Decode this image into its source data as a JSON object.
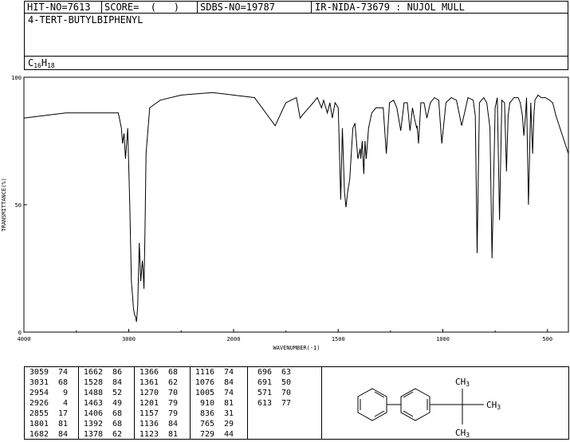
{
  "header": {
    "hit_no": "HIT-NO=7613",
    "score": "SCORE=  (   )",
    "sdbs_no": "SDBS-NO=19787",
    "ir_nida": "IR-NIDA-73679 : NUJOL MULL"
  },
  "compound_name": "4-TERT-BUTYLBIPHENYL",
  "formula": {
    "c": "C",
    "c_count": "16",
    "h": "H",
    "h_count": "18"
  },
  "chart_data": {
    "type": "line",
    "xlabel": "WAVENUMBER(-1)",
    "ylabel": "TRANSMITTANCE(%)",
    "xlim": [
      4000,
      400
    ],
    "ylim": [
      0,
      100
    ],
    "x_ticks": [
      4000,
      3000,
      2000,
      1500,
      1000,
      500
    ],
    "y_ticks": [
      0,
      50,
      100
    ],
    "series": [
      {
        "x": [
          4000,
          3800,
          3600,
          3400,
          3200,
          3100,
          3070,
          3059,
          3045,
          3031,
          3010,
          2990,
          2975,
          2960,
          2954,
          2945,
          2935,
          2926,
          2915,
          2900,
          2885,
          2870,
          2862,
          2855,
          2845,
          2835,
          2800,
          2700,
          2500,
          2200,
          2000,
          1900,
          1801,
          1750,
          1700,
          1682,
          1662,
          1620,
          1600,
          1580,
          1570,
          1552,
          1540,
          1528,
          1515,
          1500,
          1488,
          1480,
          1470,
          1463,
          1455,
          1445,
          1430,
          1420,
          1406,
          1395,
          1392,
          1385,
          1378,
          1372,
          1366,
          1355,
          1340,
          1320,
          1300,
          1285,
          1270,
          1255,
          1235,
          1220,
          1201,
          1185,
          1170,
          1157,
          1145,
          1136,
          1125,
          1123,
          1116,
          1105,
          1090,
          1076,
          1060,
          1040,
          1020,
          1005,
          985,
          960,
          935,
          910,
          880,
          855,
          845,
          836,
          825,
          805,
          790,
          775,
          765,
          750,
          740,
          729,
          718,
          705,
          696,
          688,
          680,
          670,
          660,
          650,
          640,
          630,
          620,
          613,
          605,
          600,
          591,
          580,
          571,
          565,
          560,
          545,
          530,
          510,
          490,
          475,
          460,
          440,
          420,
          400
        ],
        "y": [
          84,
          85,
          86,
          86,
          86,
          86,
          80,
          74,
          78,
          68,
          80,
          50,
          20,
          12,
          9,
          7,
          6,
          4,
          10,
          35,
          20,
          28,
          24,
          17,
          40,
          70,
          88,
          91,
          93,
          94,
          93,
          92,
          81,
          90,
          92,
          84,
          86,
          90,
          92,
          88,
          91,
          86,
          90,
          84,
          90,
          88,
          52,
          80,
          55,
          49,
          55,
          60,
          80,
          82,
          68,
          72,
          68,
          75,
          62,
          75,
          68,
          80,
          86,
          88,
          88,
          88,
          70,
          90,
          91,
          88,
          79,
          90,
          90,
          79,
          88,
          84,
          80,
          81,
          74,
          90,
          90,
          84,
          90,
          92,
          91,
          74,
          90,
          92,
          91,
          81,
          92,
          91,
          85,
          31,
          90,
          92,
          90,
          80,
          29,
          88,
          92,
          44,
          91,
          90,
          63,
          85,
          90,
          91,
          92,
          92,
          92,
          90,
          85,
          77,
          85,
          92,
          50,
          90,
          70,
          85,
          91,
          93,
          92,
          92,
          91,
          90,
          85,
          80,
          75,
          70
        ]
      }
    ],
    "peak_table": [
      [
        [
          "3059",
          "74"
        ],
        [
          "3031",
          "68"
        ],
        [
          "2954",
          "9"
        ],
        [
          "2926",
          "4"
        ],
        [
          "2855",
          "17"
        ],
        [
          "1801",
          "81"
        ],
        [
          "1682",
          "84"
        ]
      ],
      [
        [
          "1662",
          "86"
        ],
        [
          "1528",
          "84"
        ],
        [
          "1488",
          "52"
        ],
        [
          "1463",
          "49"
        ],
        [
          "1406",
          "68"
        ],
        [
          "1392",
          "68"
        ],
        [
          "1378",
          "62"
        ]
      ],
      [
        [
          "1366",
          "68"
        ],
        [
          "1361",
          "62"
        ],
        [
          "1270",
          "70"
        ],
        [
          "1201",
          "79"
        ],
        [
          "1157",
          "79"
        ],
        [
          "1136",
          "84"
        ],
        [
          "1123",
          "81"
        ]
      ],
      [
        [
          "1116",
          "74"
        ],
        [
          "1076",
          "84"
        ],
        [
          "1005",
          "74"
        ],
        [
          "910",
          "81"
        ],
        [
          "836",
          "31"
        ],
        [
          "765",
          "29"
        ],
        [
          "729",
          "44"
        ]
      ],
      [
        [
          "696",
          "63"
        ],
        [
          "691",
          "50"
        ],
        [
          "571",
          "70"
        ],
        [
          "613",
          "77"
        ]
      ]
    ]
  },
  "structure": {
    "methyl_top": "CH",
    "methyl_top_sub": "3",
    "methyl_right": "CH",
    "methyl_right_sub": "3",
    "methyl_bottom": "CH",
    "methyl_bottom_sub": "3"
  }
}
